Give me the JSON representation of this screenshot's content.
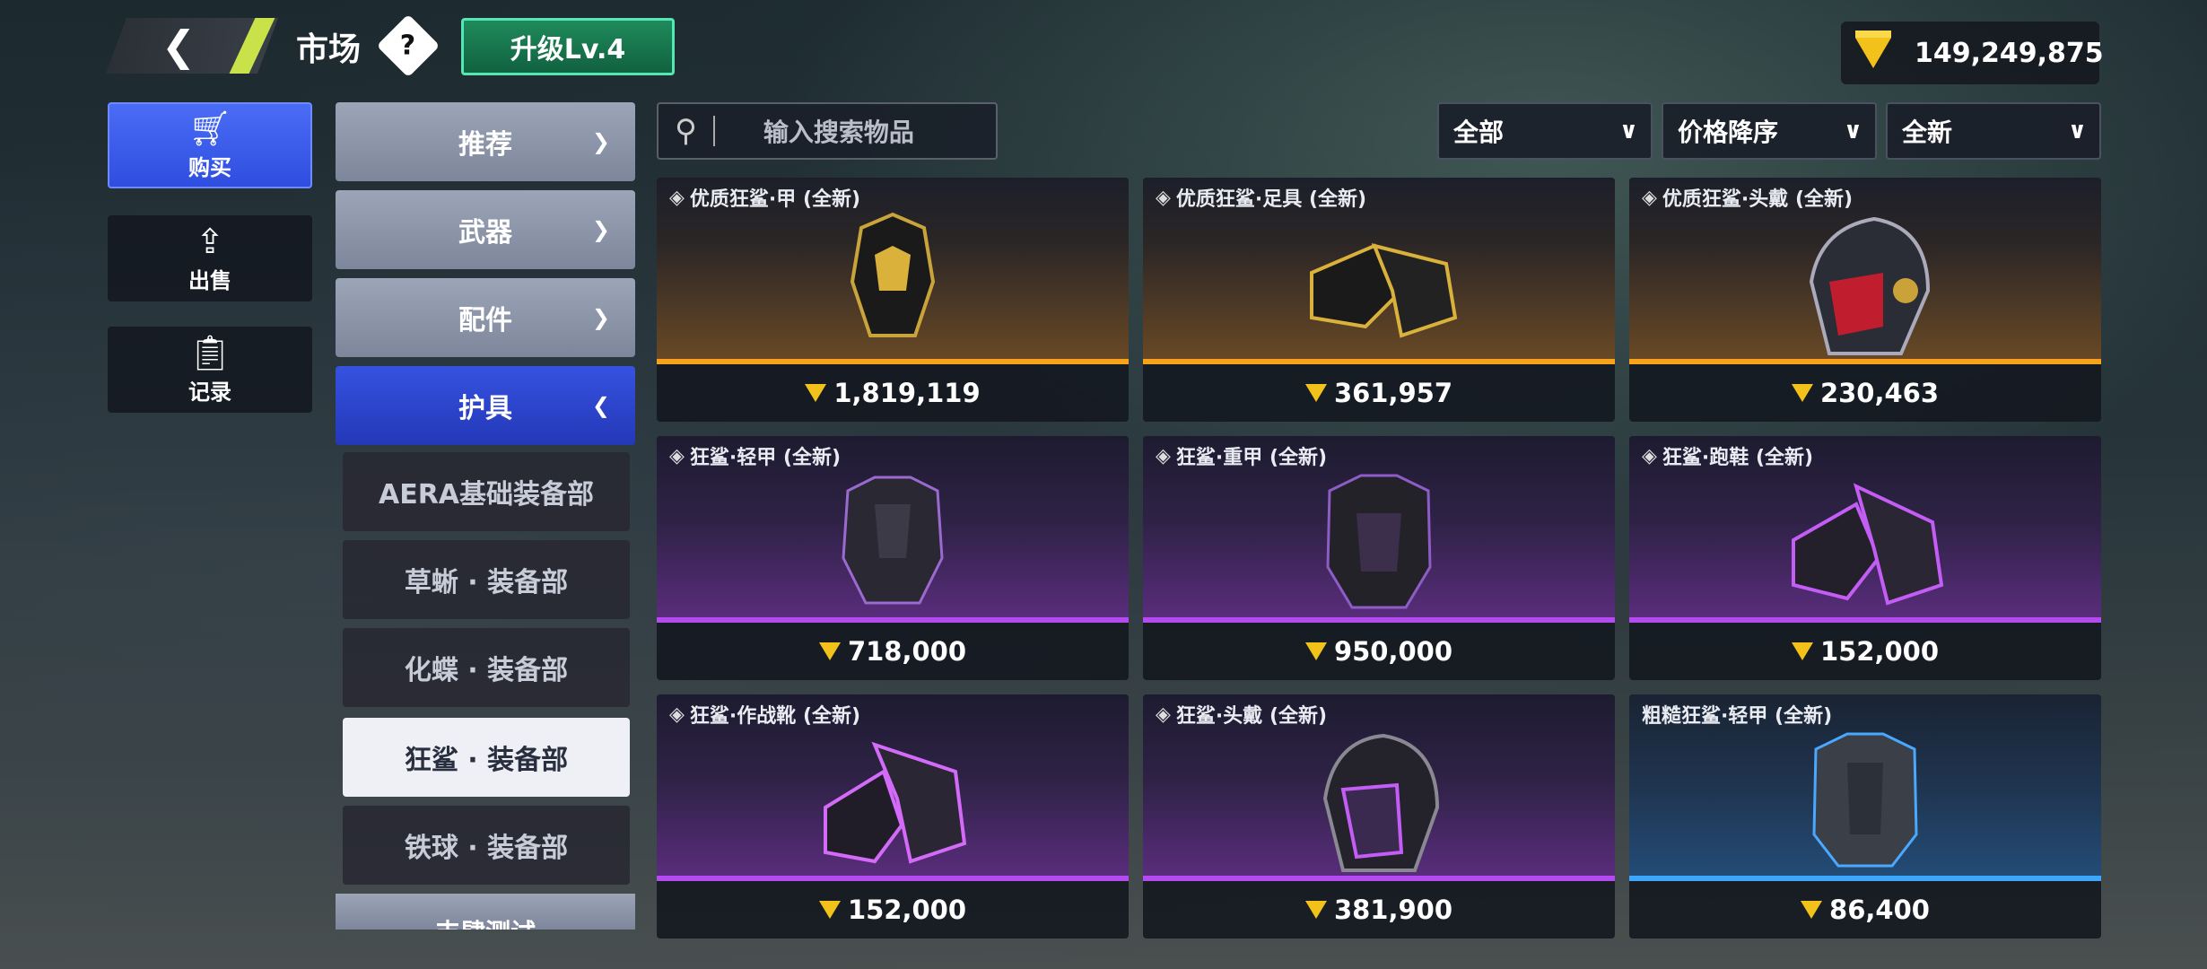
{
  "header": {
    "back_icon": "chevron-left-icon",
    "title": "市场",
    "help_label": "?",
    "level_label": "升级Lv.4",
    "currency_value": "149,249,875"
  },
  "sidebar": {
    "items": [
      {
        "label": "购买",
        "icon": "cart-icon"
      },
      {
        "label": "出售",
        "icon": "upload-icon"
      },
      {
        "label": "记录",
        "icon": "clipboard-icon"
      }
    ]
  },
  "categories": {
    "main": [
      {
        "label": "推荐"
      },
      {
        "label": "武器"
      },
      {
        "label": "配件"
      },
      {
        "label": "护具"
      }
    ],
    "sub": [
      {
        "label": "AERA基础装备部"
      },
      {
        "label": "草蜥 · 装备部"
      },
      {
        "label": "化蝶 · 装备部"
      },
      {
        "label": "狂鲨 · 装备部"
      },
      {
        "label": "铁球 · 装备部"
      }
    ],
    "cut_label": "丰肆测试"
  },
  "search": {
    "placeholder": "输入搜索物品"
  },
  "filters": [
    {
      "label": "全部"
    },
    {
      "label": "价格降序"
    },
    {
      "label": "全新"
    }
  ],
  "items": [
    {
      "name": "优质狂鲨·甲 (全新)",
      "price": "1,819,119",
      "rarity": "gold",
      "color": "#f6a21b"
    },
    {
      "name": "优质狂鲨·足具 (全新)",
      "price": "361,957",
      "rarity": "gold",
      "color": "#f6a21b"
    },
    {
      "name": "优质狂鲨·头戴 (全新)",
      "price": "230,463",
      "rarity": "gold",
      "color": "#f6a21b"
    },
    {
      "name": "狂鲨·轻甲 (全新)",
      "price": "718,000",
      "rarity": "purple",
      "color": "#b44bf0"
    },
    {
      "name": "狂鲨·重甲 (全新)",
      "price": "950,000",
      "rarity": "purple",
      "color": "#b44bf0"
    },
    {
      "name": "狂鲨·跑鞋 (全新)",
      "price": "152,000",
      "rarity": "purple",
      "color": "#b44bf0"
    },
    {
      "name": "狂鲨·作战靴 (全新)",
      "price": "152,000",
      "rarity": "purple",
      "color": "#b44bf0"
    },
    {
      "name": "狂鲨·头戴 (全新)",
      "price": "381,900",
      "rarity": "purple",
      "color": "#b44bf0"
    },
    {
      "name": "粗糙狂鲨·轻甲 (全新)",
      "price": "86,400",
      "rarity": "blue",
      "color": "#3da6ff"
    }
  ]
}
